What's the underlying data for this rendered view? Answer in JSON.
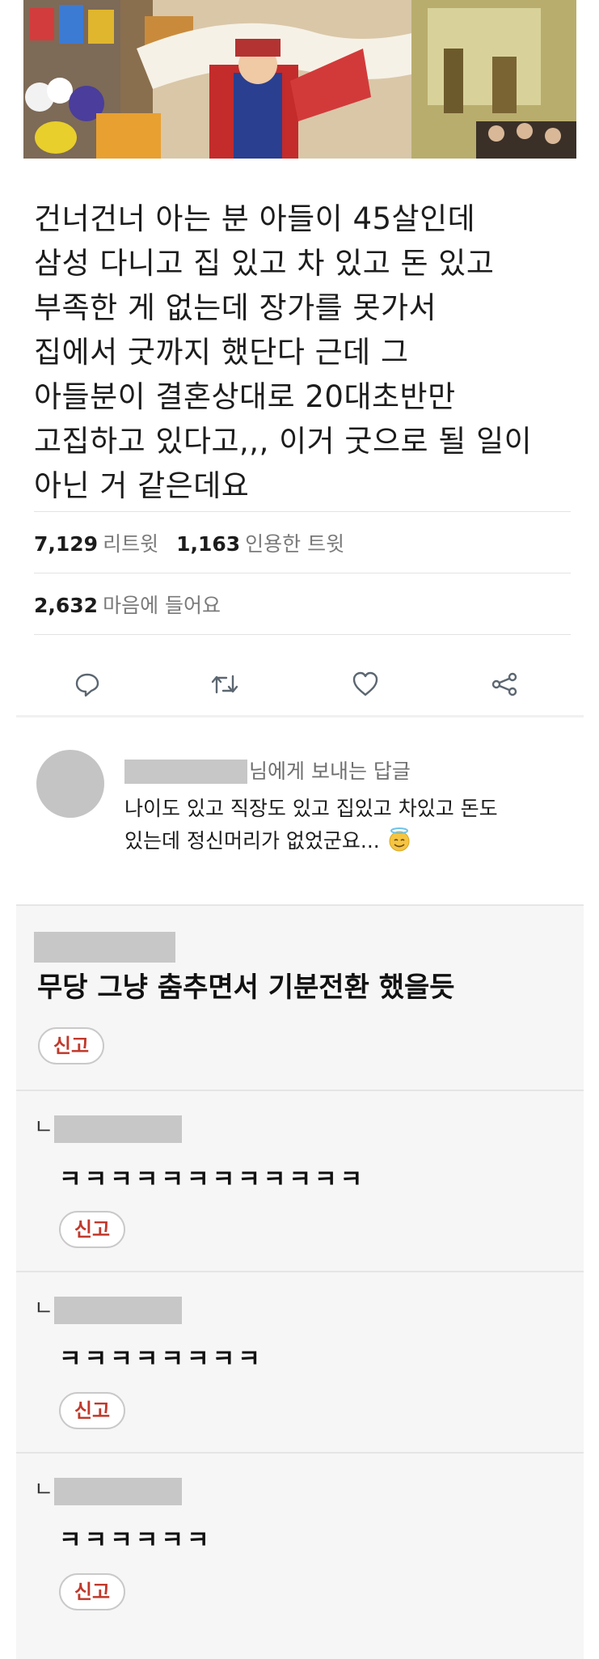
{
  "tweet": {
    "text": "건너건너 아는 분 아들이 45살인데\n삼성 다니고 집 있고 차 있고 돈 있고\n부족한 게 없는데 장가를 못가서\n집에서 굿까지 했단다 근데 그\n아들분이 결혼상대로 20대초반만\n고집하고 있다고,,, 이거 굿으로 될 일이\n아닌 거 같은데요"
  },
  "stats": {
    "retweets_count": "7,129",
    "retweets_label": "리트윗",
    "quotes_count": "1,163",
    "quotes_label": "인용한 트윗",
    "likes_count": "2,632",
    "likes_label": "마음에 들어요"
  },
  "actions": {
    "icons": [
      "reply-icon",
      "retweet-icon",
      "heart-icon",
      "share-icon"
    ]
  },
  "reply": {
    "to_suffix": "님에게 보내는 답글",
    "text": "나이도 있고 직장도 있고 집있고 차있고 돈도\n있는데 정신머리가 없었군요..."
  },
  "comments": [
    {
      "text": "무당 그냥 춤추면서 기분전환 했을듯",
      "report_label": "신고",
      "is_reply": false
    },
    {
      "reply_mark": "ㄴ",
      "text": "ㅋㅋㅋㅋㅋㅋㅋㅋㅋㅋㅋㅋ",
      "report_label": "신고",
      "is_reply": true
    },
    {
      "reply_mark": "ㄴ",
      "text": "ㅋㅋㅋㅋㅋㅋㅋㅋ",
      "report_label": "신고",
      "is_reply": true
    },
    {
      "reply_mark": "ㄴ",
      "text": "ㅋㅋㅋㅋㅋㅋ",
      "report_label": "신고",
      "is_reply": true
    }
  ],
  "colors": {
    "report_text": "#c0392b",
    "redaction": "#c7c7c7",
    "comment_bg": "#f6f6f6"
  }
}
